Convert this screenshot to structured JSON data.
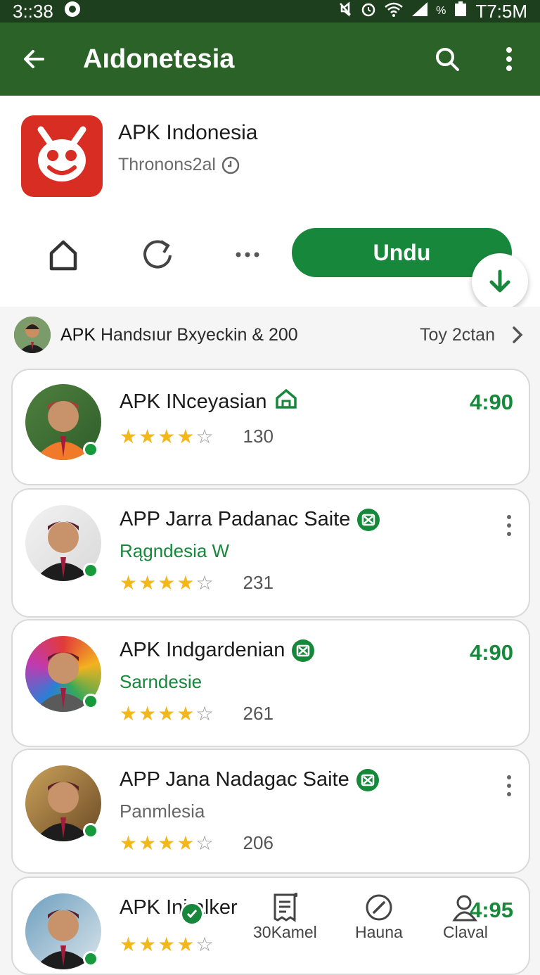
{
  "statusbar": {
    "time_left": "3::38",
    "time_right": "T7:5M",
    "battery_pct": "%"
  },
  "appbar": {
    "title": "Aıdonetesia"
  },
  "app": {
    "name": "APK Indonesia",
    "developer": "Thronons2al",
    "install_label": "Undu"
  },
  "promo": {
    "prefix": "APK",
    "text": " Handsıur Bxyeckin & 200",
    "right_text": "Toy 2ctan"
  },
  "list": [
    {
      "name": "APK INceyasian",
      "subtitle": "",
      "subtitle_color": "",
      "stars": 4,
      "count": "130",
      "score": "4:90",
      "has_menu": false
    },
    {
      "name": "APP Jarra Padanac Saite",
      "subtitle": "Rągndesia W",
      "subtitle_color": "#17883b",
      "stars": 4,
      "count": "231",
      "score": "",
      "has_menu": true
    },
    {
      "name": "APK Indgardenian",
      "subtitle": "Sarndesie",
      "subtitle_color": "#17883b",
      "stars": 4,
      "count": "261",
      "score": "4:90",
      "has_menu": false
    },
    {
      "name": "APP Jana Nadagac Saite",
      "subtitle": "Panmlesia",
      "subtitle_color": "#666666",
      "stars": 4,
      "count": "206",
      "score": "",
      "has_menu": true
    },
    {
      "name": "APK Ini alker",
      "subtitle": "",
      "subtitle_color": "",
      "stars": 4,
      "count": "",
      "score": "4:95",
      "has_menu": false
    }
  ],
  "bottom_nav": [
    {
      "label": "30Kamel"
    },
    {
      "label": "Hauna"
    },
    {
      "label": "Claval"
    }
  ],
  "colors": {
    "appbar": "#2b6228",
    "statusbar": "#1e3f1e",
    "accent_green": "#17883b",
    "star": "#f2b81b",
    "app_icon_red": "#d72d23"
  }
}
